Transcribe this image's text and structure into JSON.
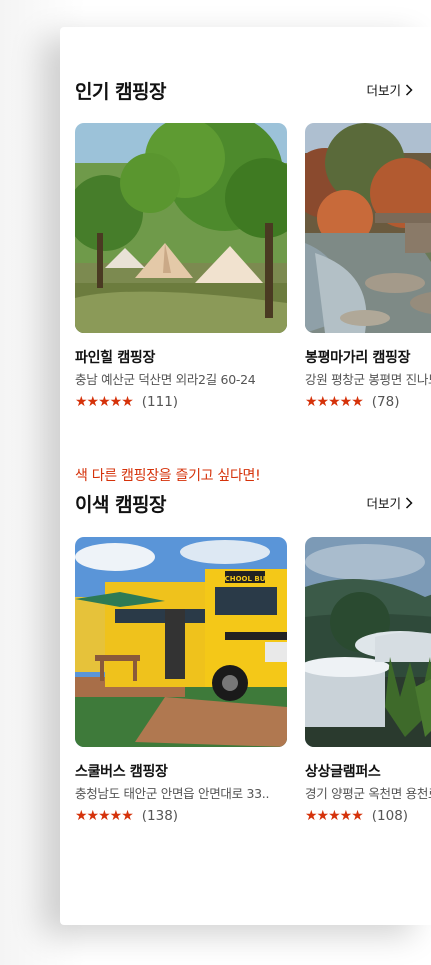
{
  "sections": [
    {
      "subtitle": "",
      "title": "인기 캠핑장",
      "more_label": "더보기",
      "cards": [
        {
          "name": "파인힐 캠핑장",
          "address": "충남 예산군 덕산면 외라2길 60-24",
          "stars": "★★★★★",
          "count": "(111)",
          "rating_out_of_5": 5
        },
        {
          "name": "봉평마가리 캠핑장",
          "address": "강원 평창군 봉평면 진나드리길",
          "stars": "★★★★★",
          "count": "(78)",
          "rating_out_of_5": 5
        }
      ]
    },
    {
      "subtitle": "색 다른 캠핑장을 즐기고 싶다면!",
      "title": "이색 캠핑장",
      "more_label": "더보기",
      "cards": [
        {
          "name": "스쿨버스 캠핑장",
          "address": "충청남도 태안군 안면읍 안면대로 33..",
          "stars": "★★★★★",
          "count": "(138)",
          "rating_out_of_5": 5,
          "bus_sign": "SCHOOL BUS"
        },
        {
          "name": "상상글램퍼스",
          "address": "경기 양평군 옥천면 용천로",
          "stars": "★★★★★",
          "count": "(108)",
          "rating_out_of_5": 5
        }
      ]
    }
  ],
  "colors": {
    "accent": "#d5320a",
    "text": "#111111",
    "muted": "#555555"
  },
  "icons": {
    "more": "chevron-right-icon"
  }
}
